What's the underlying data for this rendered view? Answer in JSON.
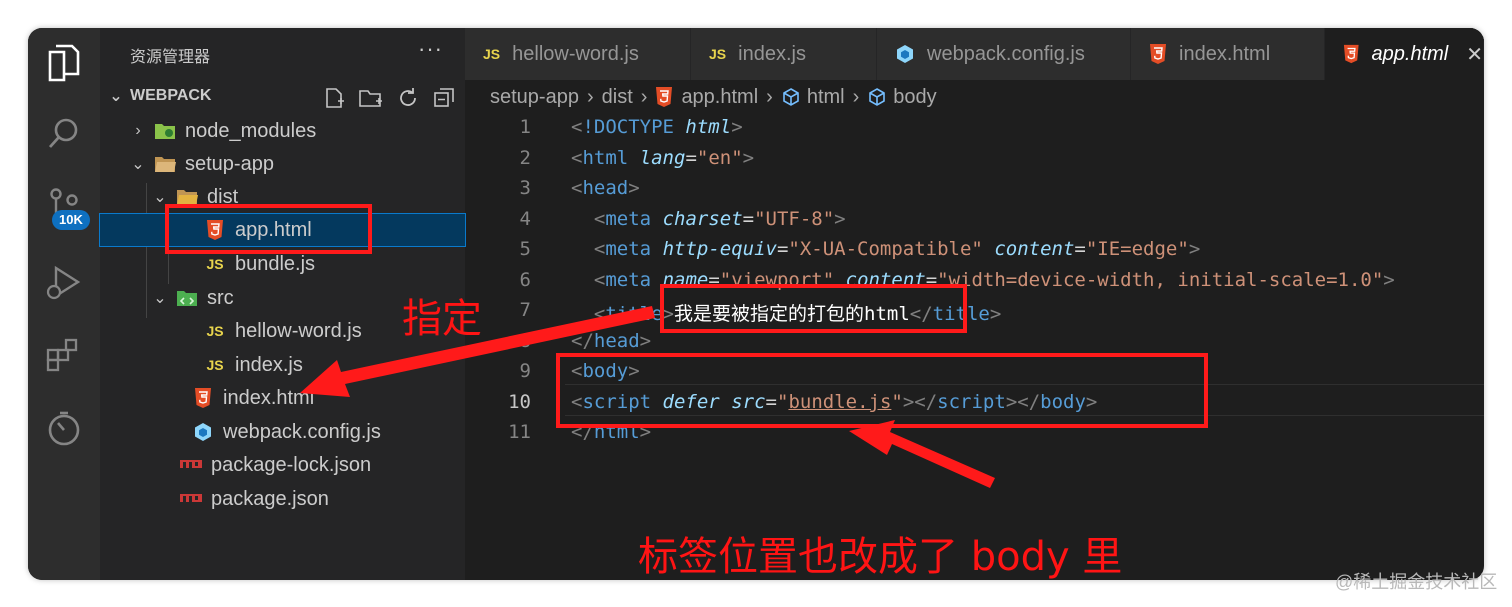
{
  "sidebar": {
    "title": "资源管理器",
    "more": "···",
    "section": "WEBPACK",
    "tree": [
      {
        "label": "node_modules"
      },
      {
        "label": "setup-app"
      },
      {
        "label": "dist"
      },
      {
        "label": "app.html"
      },
      {
        "label": "bundle.js"
      },
      {
        "label": "src"
      },
      {
        "label": "hellow-word.js"
      },
      {
        "label": "index.js"
      },
      {
        "label": "index.html"
      },
      {
        "label": "webpack.config.js"
      },
      {
        "label": "package-lock.json"
      },
      {
        "label": "package.json"
      }
    ]
  },
  "activity": {
    "badge": "10K"
  },
  "tabs": [
    {
      "label": "hellow-word.js"
    },
    {
      "label": "index.js"
    },
    {
      "label": "webpack.config.js"
    },
    {
      "label": "index.html"
    },
    {
      "label": "app.html"
    }
  ],
  "breadcrumb": [
    "setup-app",
    "dist",
    "app.html",
    "html",
    "body"
  ],
  "editor": {
    "line_numbers": [
      "1",
      "2",
      "3",
      "4",
      "5",
      "6",
      "7",
      "8",
      "9",
      "10",
      "11"
    ],
    "title_text": "我是要被指定的打包的html"
  },
  "annotations": {
    "specified": "指定",
    "moved": "标签位置也改成了 body 里"
  },
  "watermark": "@稀土掘金技术社区",
  "colors": {
    "annotation_red": "#ff1a1a",
    "badge_blue": "#0e70c0",
    "selection": "#04395e"
  }
}
